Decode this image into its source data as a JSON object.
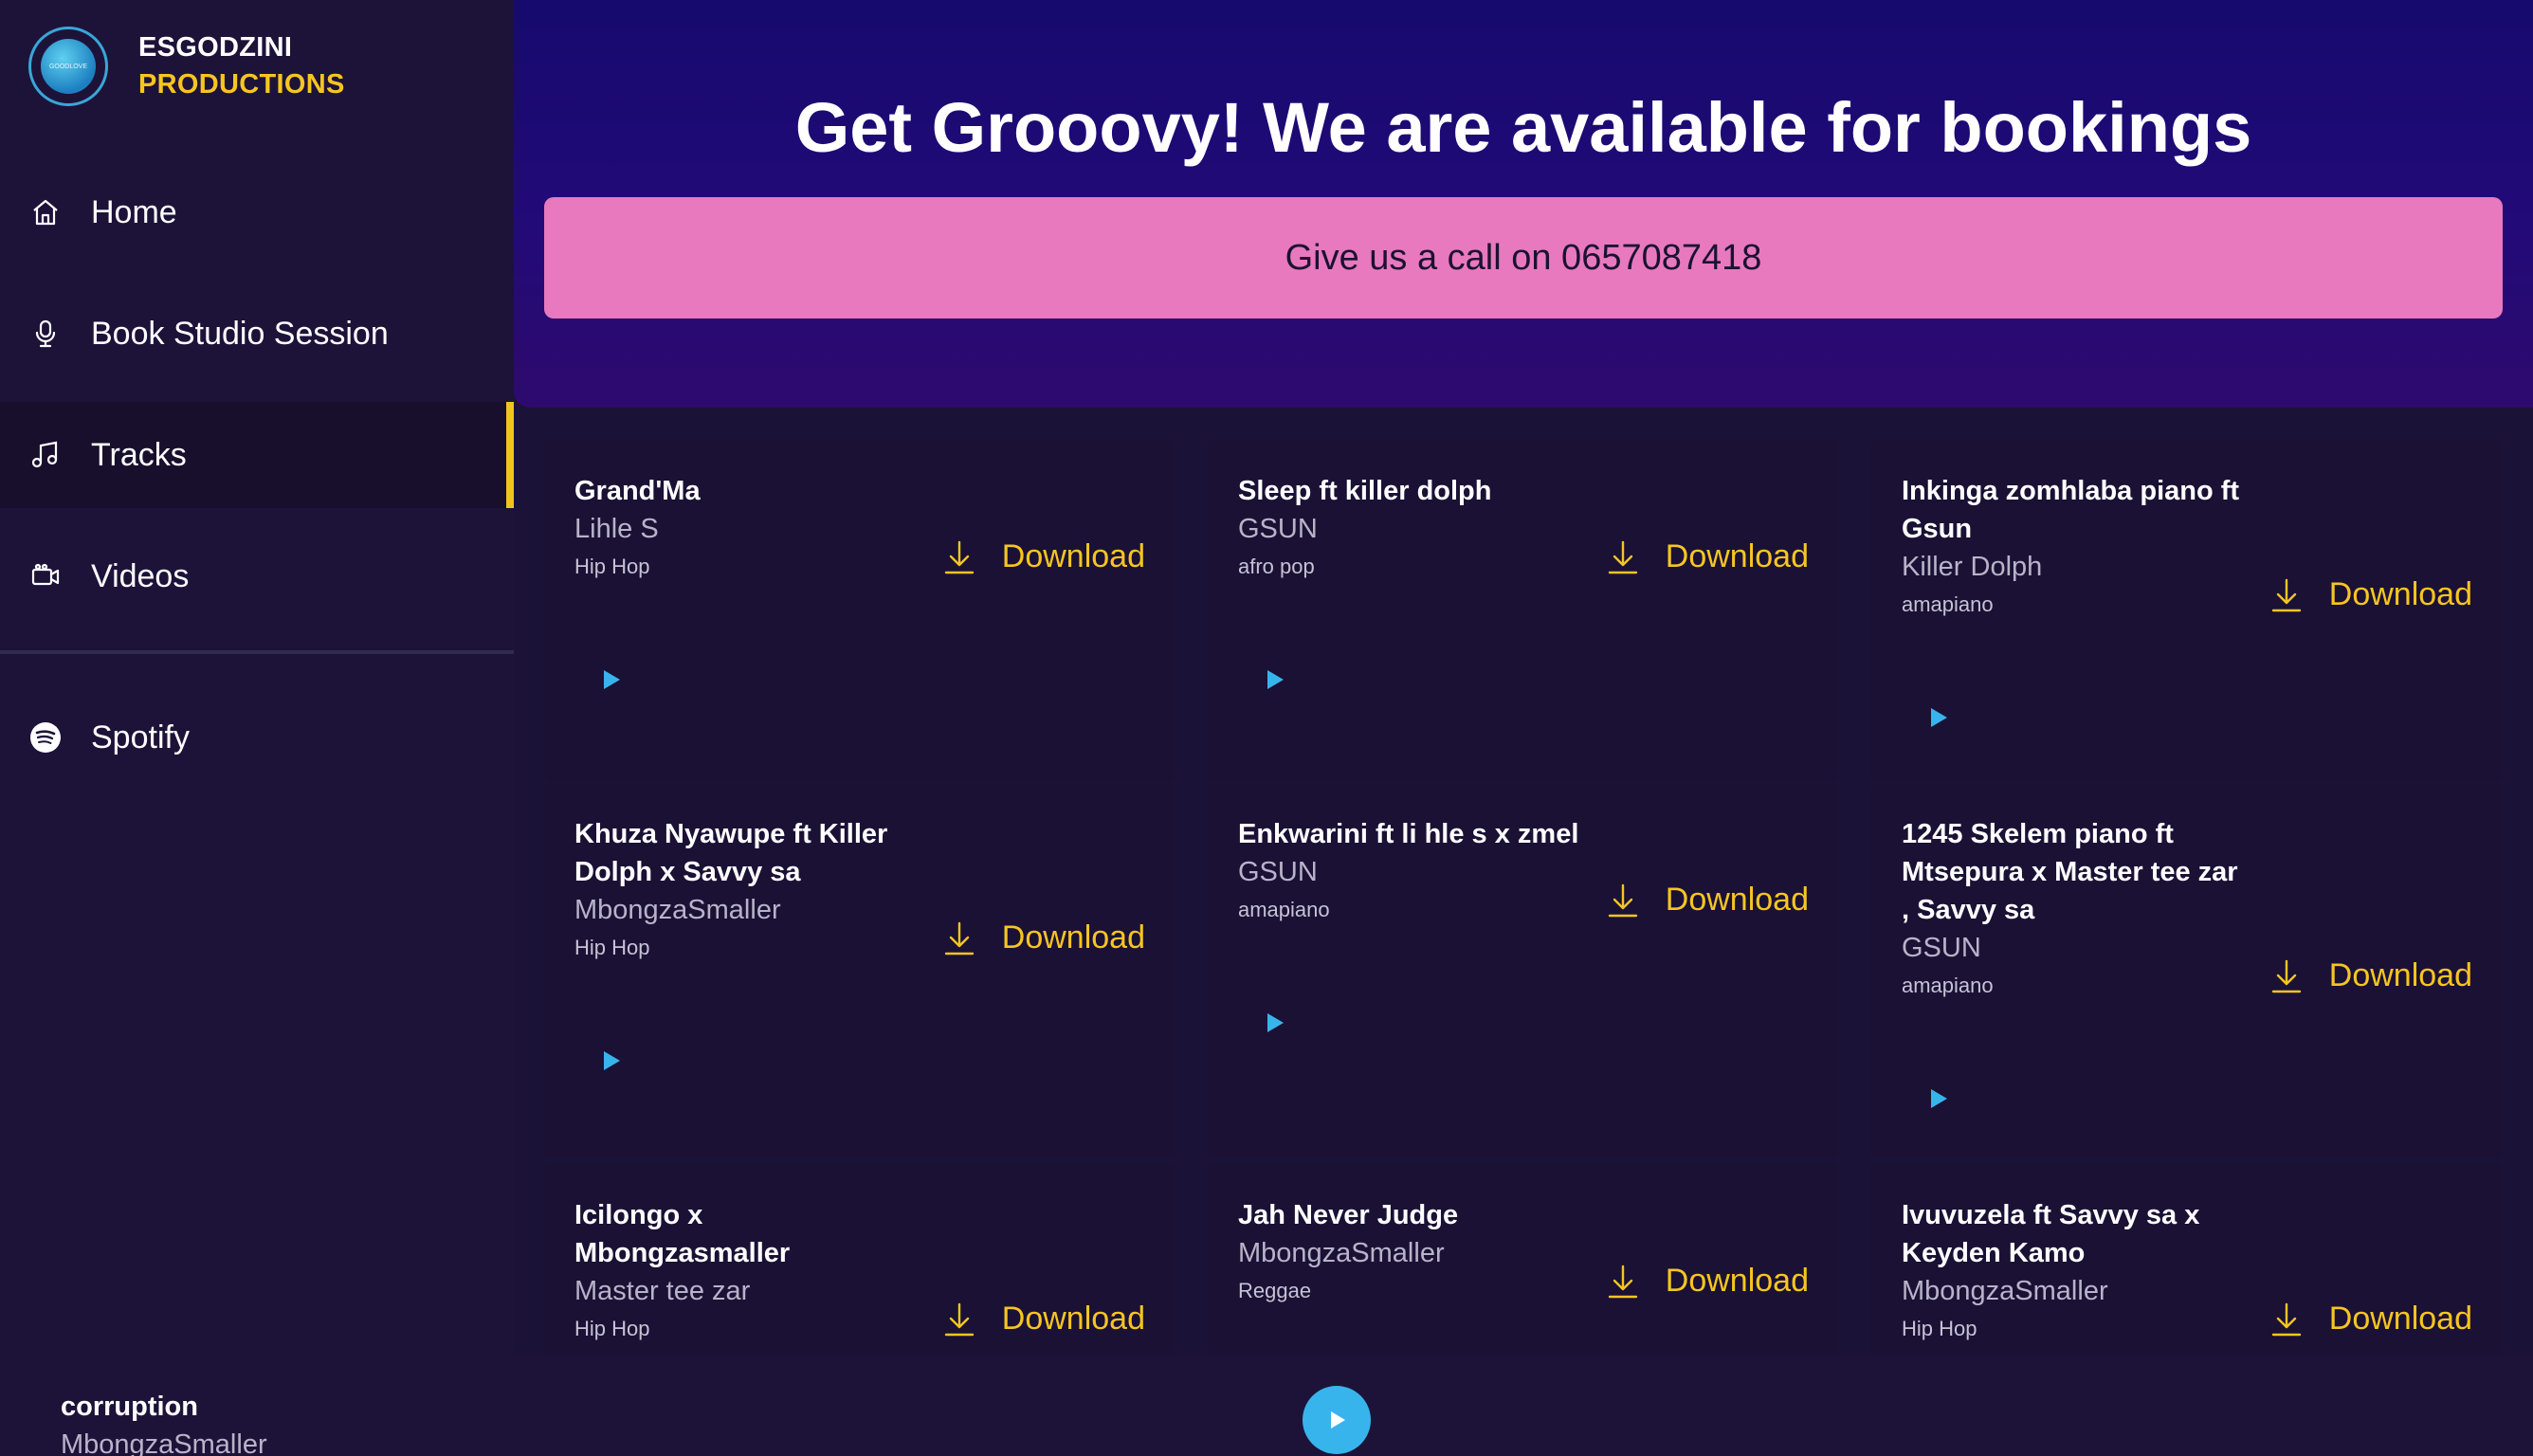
{
  "brand": {
    "line1": "ESGODZINI",
    "line2": "PRODUCTIONS",
    "logo_text": "GOODLOVE"
  },
  "nav": {
    "items": [
      {
        "label": "Home",
        "icon": "home-icon"
      },
      {
        "label": "Book Studio Session",
        "icon": "microphone-icon"
      },
      {
        "label": "Tracks",
        "icon": "music-note-icon",
        "active": true
      },
      {
        "label": "Videos",
        "icon": "video-camera-icon"
      }
    ],
    "spotify": {
      "label": "Spotify",
      "icon": "spotify-icon"
    }
  },
  "hero": {
    "title": "Get Grooovy! We are available for bookings",
    "call_label": "Give us a call on 0657087418"
  },
  "download_label": "Download",
  "tracks": [
    {
      "title": "Grand'Ma",
      "artist": "Lihle S",
      "genre": "Hip Hop"
    },
    {
      "title": "Sleep ft killer dolph",
      "artist": "GSUN",
      "genre": "afro pop"
    },
    {
      "title": "Inkinga zomhlaba piano ft Gsun",
      "artist": "Killer Dolph",
      "genre": "amapiano"
    },
    {
      "title": "Khuza Nyawupe ft Killer Dolph x Savvy sa",
      "artist": "MbongzaSmaller",
      "genre": "Hip Hop"
    },
    {
      "title": "Enkwarini ft li hle s x zmel",
      "artist": "GSUN",
      "genre": "amapiano"
    },
    {
      "title": "1245 Skelem piano ft Mtsepura x Master tee zar , Savvy sa",
      "artist": "GSUN",
      "genre": "amapiano"
    },
    {
      "title": "Icilongo x Mbongzasmaller",
      "artist": "Master tee zar",
      "genre": "Hip Hop"
    },
    {
      "title": "Jah Never Judge",
      "artist": "MbongzaSmaller",
      "genre": "Reggae"
    },
    {
      "title": "Ivuvuzela ft Savvy sa x Keyden Kamo",
      "artist": "MbongzaSmaller",
      "genre": "Hip Hop"
    }
  ],
  "player": {
    "title": "corruption",
    "artist": "MbongzaSmaller"
  },
  "colors": {
    "accent": "#f7c520",
    "pink": "#e879bf",
    "play": "#38b4ec",
    "bg": "#1b1238"
  }
}
